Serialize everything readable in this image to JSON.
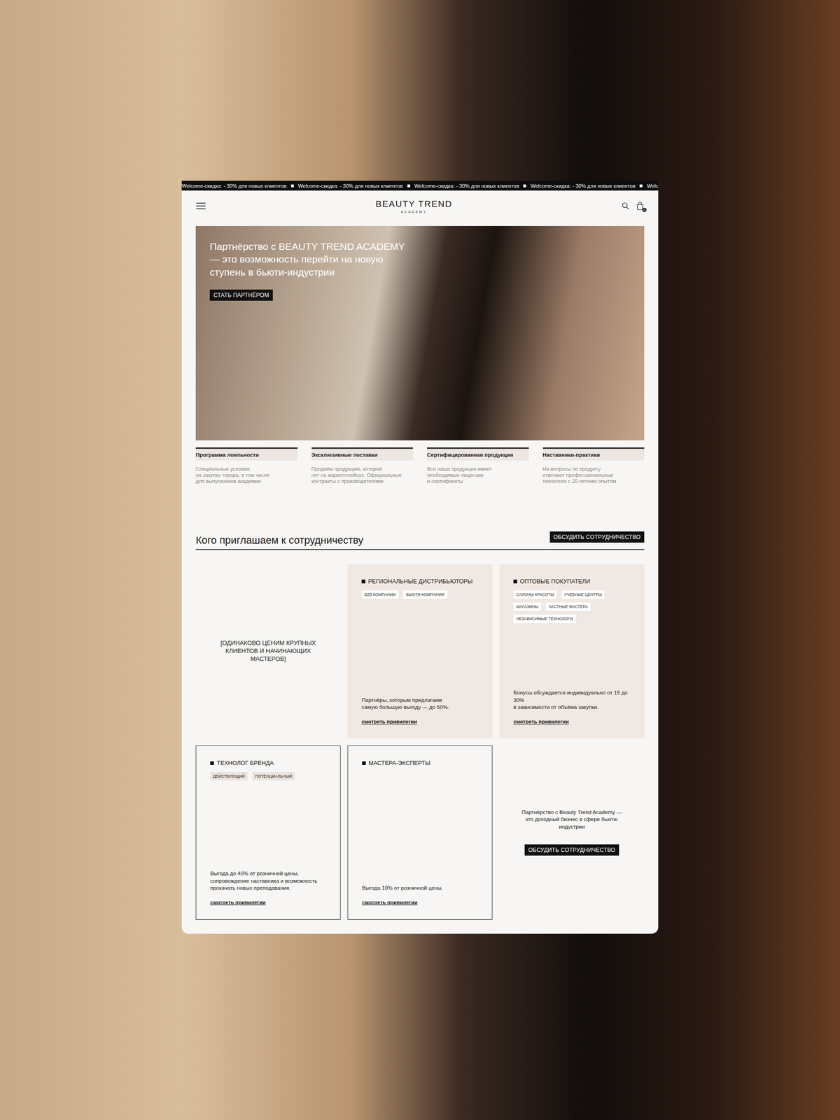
{
  "marquee": {
    "items": [
      "Welcome-скидка: - 30% для новых клиентов",
      "Welcome-скидка: - 30% для новых клиентов",
      "Welcome-скидка: - 30% для новых клиентов",
      "Welcome-скидка: - 30% для новых клиентов",
      "Welc"
    ]
  },
  "header": {
    "logo": "BEAUTY TREND",
    "logo_sub": "ACADEMY",
    "cart_count": "0"
  },
  "hero": {
    "title": "Партнёрство с BEAUTY TREND ACADEMY\n— это возможность перейти на новую\nступень в бьюти-индустрии",
    "button": "СТАТЬ ПАРТНЁРОМ"
  },
  "features": [
    {
      "title": "Программа лояльности",
      "description": "Специальные условия\nна закупку товара, в том числе\nдля выпускников академии"
    },
    {
      "title": "Эксклюзивные поставки",
      "description": "Продаём продукцию, которой\nнет на маркетплейсах. Официальные\nконтракты с производителями"
    },
    {
      "title": "Сертифицированная продукция",
      "description": "Вся наша продукция имеет\nнеобходимые лицензии\nи сертификаты"
    },
    {
      "title": "Наставники-практики",
      "description": "На вопросы по продукту\nотвечают профессиональные\nтехнологи с 20-летним опытом"
    }
  ],
  "section": {
    "title": "Кого приглашаем к сотрудничеству",
    "button": "ОБСУДИТЬ СОТРУДНИЧЕСТВО"
  },
  "partners": [
    {
      "kind": "statement",
      "text": "[ОДИНАКОВО ЦЕНИМ КРУПНЫХ\nКЛИЕНТОВ И НАЧИНАЮЩИХ МАСТЕРОВ]"
    },
    {
      "kind": "filled",
      "title": "РЕГИОНАЛЬНЫЕ ДИСТРИБЬЮТОРЫ",
      "tags": [
        "B2B КОМПАНИИ",
        "БЬЮТИ-КОМПАНИИ"
      ],
      "text": "Партнёры, которым предлагаем\nсамую большую выгоду — до 50%.",
      "link": "смотреть привилегии"
    },
    {
      "kind": "filled",
      "title": "ОПТОВЫЕ ПОКУПАТЕЛИ",
      "tags": [
        "САЛОНЫ КРАСОТЫ",
        "УЧЕБНЫЕ ЦЕНТРЫ",
        "МАГАЗИНЫ",
        "ЧАСТНЫЕ МАСТЕРА",
        "НЕЗАВИСИМЫЕ ТЕХНОЛОГИ"
      ],
      "text": "Бонусы обсуждается индивидуально от 15 до 30%\nв зависимости от объёма закупки.",
      "link": "смотреть привилегии"
    },
    {
      "kind": "outlined",
      "title": "ТЕХНОЛОГ БРЕНДА",
      "tags": [
        "ДЕЙСТВУЮЩИЙ",
        "ПОТЕНЦИАЛЬНЫЙ"
      ],
      "text": "Выгода до 40% от розничной цены,\nсопровождение наставника и возможность\nпрокачать новых преподавания.",
      "link": "смотреть привилегии"
    },
    {
      "kind": "outlined",
      "title": "МАСТЕРА-ЭКСПЕРТЫ",
      "tags": [],
      "text": "Выгода 10% от розничной цены.",
      "link": "смотреть привилегии"
    },
    {
      "kind": "cta",
      "text": "Партнёрство с Beauty Trend Academy —\nэто доходный бизнес в сфере бьюти-\nиндустрии",
      "button": "ОБСУДИТЬ СОТРУДНИЧЕСТВО"
    }
  ]
}
